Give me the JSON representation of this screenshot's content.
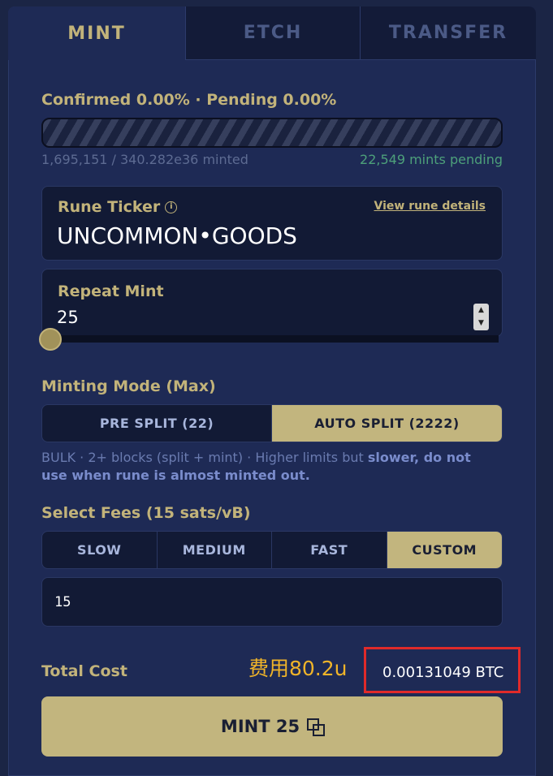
{
  "tabs": [
    "MINT",
    "ETCH",
    "TRANSFER"
  ],
  "mint": {
    "status": "Confirmed 0.00% · Pending 0.00%",
    "progress_confirmed_pct": 0,
    "minted": "1,695,151 / 340.282e36 minted",
    "pending": "22,549 mints pending",
    "ticker": {
      "label": "Rune Ticker",
      "view_link": "View rune details",
      "value": "UNCOMMON•GOODS"
    },
    "repeat": {
      "label": "Repeat Mint",
      "value": "25"
    },
    "minting_mode": {
      "label": "Minting Mode (Max)",
      "options": [
        "PRE SPLIT (22)",
        "AUTO SPLIT (2222)"
      ],
      "selected": "AUTO SPLIT (2222)",
      "desc_plain": "BULK · 2+ blocks (split + mint) · Higher limits but ",
      "desc_bold": "slower, do not use when rune is almost minted out."
    },
    "fees": {
      "label": "Select Fees (15 sats/vB)",
      "options": [
        "SLOW",
        "MEDIUM",
        "FAST",
        "CUSTOM"
      ],
      "selected": "CUSTOM",
      "custom_value": "15"
    },
    "total": {
      "label": "Total Cost",
      "annotation": "费用80.2u",
      "value": "0.00131049 BTC"
    },
    "mint_button": "MINT 25"
  },
  "colors": {
    "accent": "#c2b57e",
    "background": "#1e2a55",
    "highlight_box": "#e02a2a",
    "annotation": "#f0b429"
  }
}
